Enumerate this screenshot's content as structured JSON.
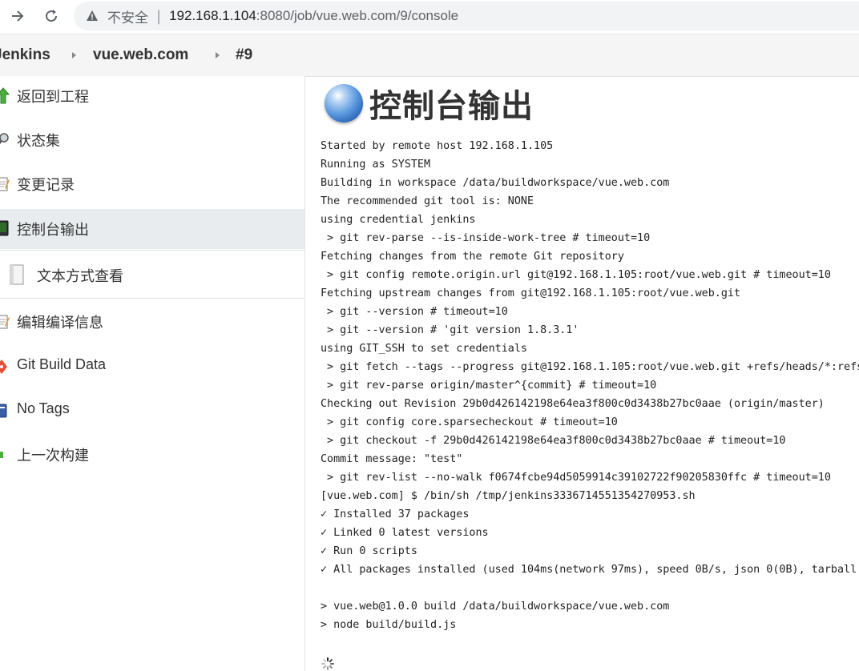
{
  "browser": {
    "security_label": "不安全",
    "url_host": "192.168.1.104",
    "url_rest": ":8080/job/vue.web.com/9/console"
  },
  "breadcrumb": {
    "items": [
      "Jenkins",
      "vue.web.com",
      "#9"
    ]
  },
  "sidebar": {
    "items": [
      {
        "label": "返回到工程",
        "icon": "up-arrow-icon"
      },
      {
        "label": "状态集",
        "icon": "magnifier-icon"
      },
      {
        "label": "变更记录",
        "icon": "notepad-icon"
      },
      {
        "label": "控制台输出",
        "icon": "terminal-icon",
        "active": true
      },
      {
        "label": "文本方式查看",
        "icon": "document-icon"
      },
      {
        "label": "编辑编译信息",
        "icon": "notepad-icon"
      },
      {
        "label": "Git Build Data",
        "icon": "git-icon"
      },
      {
        "label": "No Tags",
        "icon": "tag-icon"
      },
      {
        "label": "上一次构建",
        "icon": "left-arrow-icon"
      }
    ]
  },
  "main": {
    "title": "控制台输出",
    "console_lines": [
      "Started by remote host 192.168.1.105",
      "Running as SYSTEM",
      "Building in workspace /data/buildworkspace/vue.web.com",
      "The recommended git tool is: NONE",
      "using credential jenkins",
      " > git rev-parse --is-inside-work-tree # timeout=10",
      "Fetching changes from the remote Git repository",
      " > git config remote.origin.url git@192.168.1.105:root/vue.web.git # timeout=10",
      "Fetching upstream changes from git@192.168.1.105:root/vue.web.git",
      " > git --version # timeout=10",
      " > git --version # 'git version 1.8.3.1'",
      "using GIT_SSH to set credentials",
      " > git fetch --tags --progress git@192.168.1.105:root/vue.web.git +refs/heads/*:refs",
      " > git rev-parse origin/master^{commit} # timeout=10",
      "Checking out Revision 29b0d426142198e64ea3f800c0d3438b27bc0aae (origin/master)",
      " > git config core.sparsecheckout # timeout=10",
      " > git checkout -f 29b0d426142198e64ea3f800c0d3438b27bc0aae # timeout=10",
      "Commit message: \"test\"",
      " > git rev-list --no-walk f0674fcbe94d5059914c39102722f90205830ffc # timeout=10",
      "[vue.web.com] $ /bin/sh /tmp/jenkins3336714551354270953.sh",
      "✓ Installed 37 packages",
      "✓ Linked 0 latest versions",
      "✓ Run 0 scripts",
      "✓ All packages installed (used 104ms(network 97ms), speed 0B/s, json 0(0B), tarball",
      "",
      "> vue.web@1.0.0 build /data/buildworkspace/vue.web.com",
      "> node build/build.js"
    ]
  }
}
